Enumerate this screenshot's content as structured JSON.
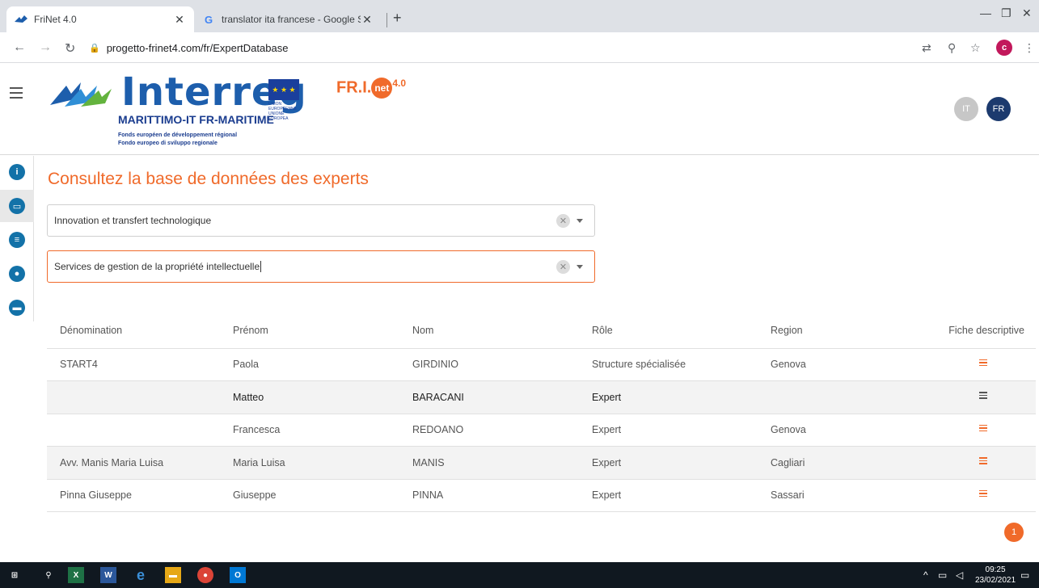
{
  "browser": {
    "tabs": [
      {
        "title": "FriNet 4.0",
        "active": true
      },
      {
        "title": "translator ita francese - Google S",
        "active": false
      }
    ],
    "url": "progetto-frinet4.com/fr/ExpertDatabase",
    "profile_initial": "c"
  },
  "header": {
    "logo_word": "Interreg",
    "program": "MARITTIMO-IT FR-MARITIME",
    "fonds_fr": "Fonds européen de développement régional",
    "fonds_it": "Fondo europeo di sviluppo regionale",
    "eu_text": "UNION EUROPÉENNE UNIONE EUROPEA",
    "frinet_prefix": "FR.I.",
    "frinet_circle": "net",
    "frinet_sup": "4.0",
    "languages": [
      "IT",
      "FR"
    ]
  },
  "sidebar": {
    "icons": [
      "info-icon",
      "chat-icon",
      "list-icon",
      "user-icon",
      "folder-icon"
    ]
  },
  "main": {
    "title": "Consultez la base de données des experts",
    "filter1": "Innovation et transfert technologique",
    "filter2": "Services de gestion de la propriété intellectuelle"
  },
  "table": {
    "columns": [
      "Dénomination",
      "Prénom",
      "Nom",
      "Rôle",
      "Region",
      "Fiche descriptive"
    ],
    "rows": [
      [
        "START4",
        "Paola",
        "GIRDINIO",
        "Structure spécialisée",
        "Genova"
      ],
      [
        "",
        "Matteo",
        "BARACANI",
        "Expert",
        ""
      ],
      [
        "",
        "Francesca",
        "REDOANO",
        "Expert",
        "Genova"
      ],
      [
        "Avv. Manis Maria Luisa",
        "Maria Luisa",
        "MANIS",
        "Expert",
        "Cagliari"
      ],
      [
        "Pinna Giuseppe",
        "Giuseppe",
        "PINNA",
        "Expert",
        "Sassari"
      ]
    ]
  },
  "pagination": {
    "current": "1"
  },
  "taskbar": {
    "time": "09:25",
    "date": "23/02/2021"
  },
  "colors": {
    "accent": "#f06a2a",
    "brand": "#1d5eac",
    "rail": "#1372a8"
  }
}
